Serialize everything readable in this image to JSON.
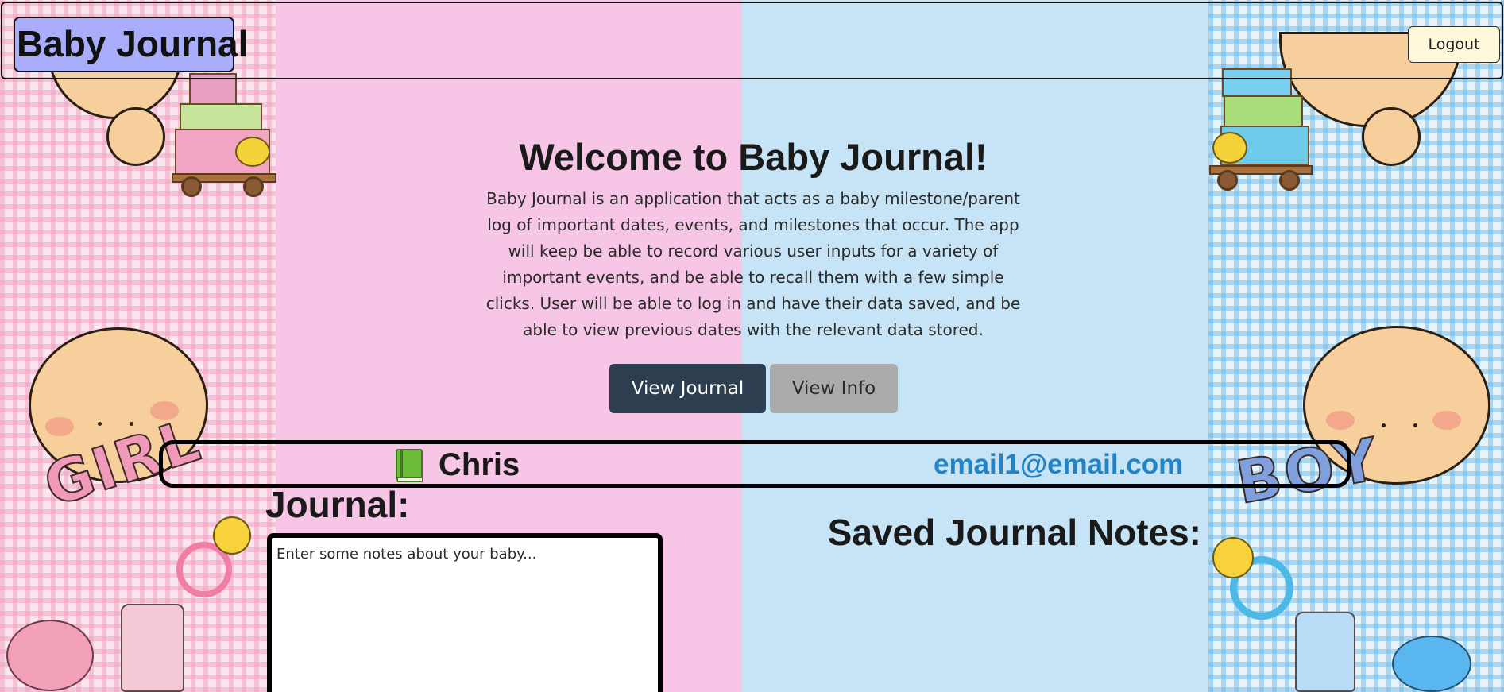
{
  "navbar": {
    "brand": "Baby Journal",
    "logout_label": "Logout"
  },
  "hero": {
    "title": "Welcome to Baby Journal!",
    "description": "Baby Journal is an application that acts as a baby milestone/parent log of important dates, events, and milestones that occur. The app will keep be able to record various user inputs for a variety of important events, and be able to recall them with a few simple clicks. User will be able to log in and have their data saved, and be able to view previous dates with the relevant data stored.",
    "view_journal_label": "View Journal",
    "view_info_label": "View Info"
  },
  "user": {
    "icon": "green-book-icon",
    "name": "Chris",
    "email": "email1@email.com"
  },
  "journal": {
    "heading": "Journal:",
    "placeholder": "Enter some notes about your baby...",
    "saved_heading": "Saved Journal Notes:"
  },
  "background": {
    "left_letters": "GIRL",
    "right_letters": "BOY"
  },
  "colors": {
    "brand_bg": "#a9adfc",
    "logout_bg": "#fff7d9",
    "pink_panel": "#f7c5e6",
    "blue_panel": "#c6e4f6",
    "primary_button": "#2d3e50",
    "secondary_button": "#ababab",
    "email_link": "#2383c4"
  }
}
